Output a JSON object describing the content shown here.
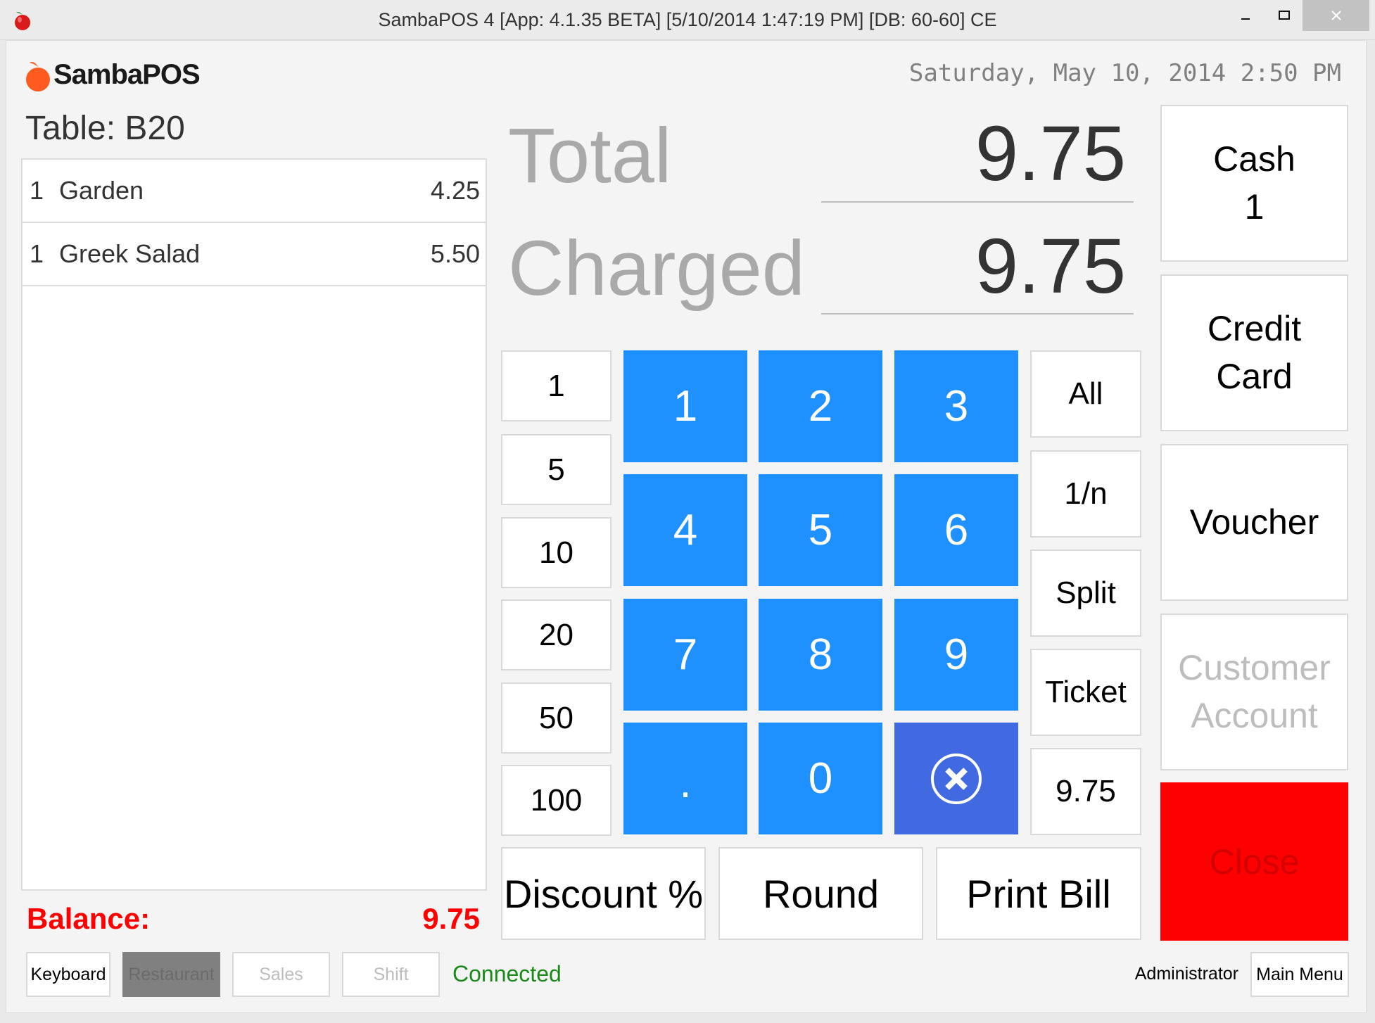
{
  "window": {
    "title": "SambaPOS 4 [App: 4.1.35 BETA] [5/10/2014 1:47:19 PM] [DB: 60-60] CE",
    "app_icon": "apple-icon",
    "controls": {
      "minimize": "—",
      "maximize": "☐",
      "close": "✕"
    }
  },
  "header": {
    "logo_text": "SambaPOS",
    "datetime": "Saturday, May 10, 2014 2:50 PM"
  },
  "ticket": {
    "table_label": "Table: B20",
    "items": [
      {
        "qty": "1",
        "name": "Garden",
        "price": "4.25"
      },
      {
        "qty": "1",
        "name": "Greek Salad",
        "price": "5.50"
      }
    ],
    "balance_label": "Balance:",
    "balance_value": "9.75"
  },
  "summary": {
    "total_label": "Total",
    "total_value": "9.75",
    "charged_label": "Charged",
    "charged_value": "9.75"
  },
  "quick_amounts": [
    "1",
    "5",
    "10",
    "20",
    "50",
    "100"
  ],
  "numpad": {
    "keys": [
      "1",
      "2",
      "3",
      "4",
      "5",
      "6",
      "7",
      "8",
      "9",
      ".",
      "0"
    ],
    "clear_icon": "clear-circle-x-icon",
    "colors": {
      "key": "#1E90FF",
      "clear": "#4169E1"
    }
  },
  "split_options": [
    "All",
    "1/n",
    "Split",
    "Ticket",
    "9.75"
  ],
  "actions": {
    "discount": "Discount %",
    "round": "Round",
    "print_bill": "Print Bill"
  },
  "payment_methods": [
    {
      "label_line1": "Cash",
      "label_line2": "1",
      "enabled": true
    },
    {
      "label_line1": "Credit",
      "label_line2": "Card",
      "enabled": true
    },
    {
      "label_line1": "Voucher",
      "label_line2": "",
      "enabled": true
    },
    {
      "label_line1": "Customer",
      "label_line2": "Account",
      "enabled": false
    }
  ],
  "close_button": {
    "label": "Close",
    "color": "#FF0000"
  },
  "footer": {
    "buttons": [
      {
        "label": "Keyboard",
        "state": "normal"
      },
      {
        "label": "Restaurant",
        "state": "active"
      },
      {
        "label": "Sales",
        "state": "disabled"
      },
      {
        "label": "Shift",
        "state": "disabled"
      }
    ],
    "connection_status": "Connected",
    "user": "Administrator",
    "main_menu": "Main Menu"
  }
}
